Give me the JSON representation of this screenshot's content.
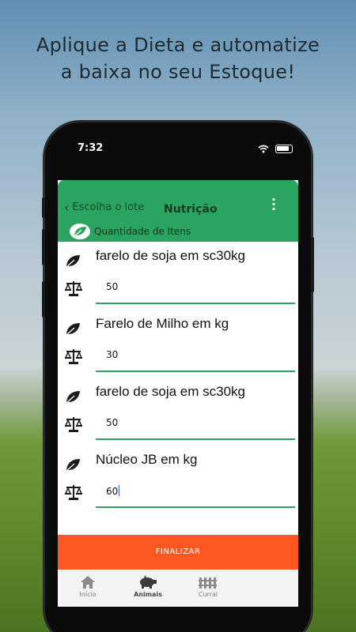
{
  "headline": {
    "line1": "Aplique a Dieta e automatize",
    "line2": "a baixa no seu Estoque!"
  },
  "status_bar": {
    "time": "7:32",
    "wifi_icon": "wifi-icon",
    "battery_icon": "battery-icon"
  },
  "app_bar": {
    "back_label": "Escolha o lote",
    "title": "Nutrição",
    "subtitle": "Quantidade de Itens",
    "background": "#2aa561"
  },
  "items": [
    {
      "name": "farelo de soja em sc30kg",
      "quantity": "50"
    },
    {
      "name": "Farelo de Milho em kg",
      "quantity": "30"
    },
    {
      "name": "farelo de soja em sc30kg",
      "quantity": "50"
    },
    {
      "name": "Núcleo JB em kg",
      "quantity": "60"
    }
  ],
  "finalize_button": {
    "label": "FINALIZAR",
    "color": "#ff5722"
  },
  "bottom_nav": [
    {
      "label": "Início",
      "icon": "home-icon"
    },
    {
      "label": "Animais",
      "icon": "pig-icon",
      "active": true
    },
    {
      "label": "Curral",
      "icon": "fence-icon"
    }
  ]
}
